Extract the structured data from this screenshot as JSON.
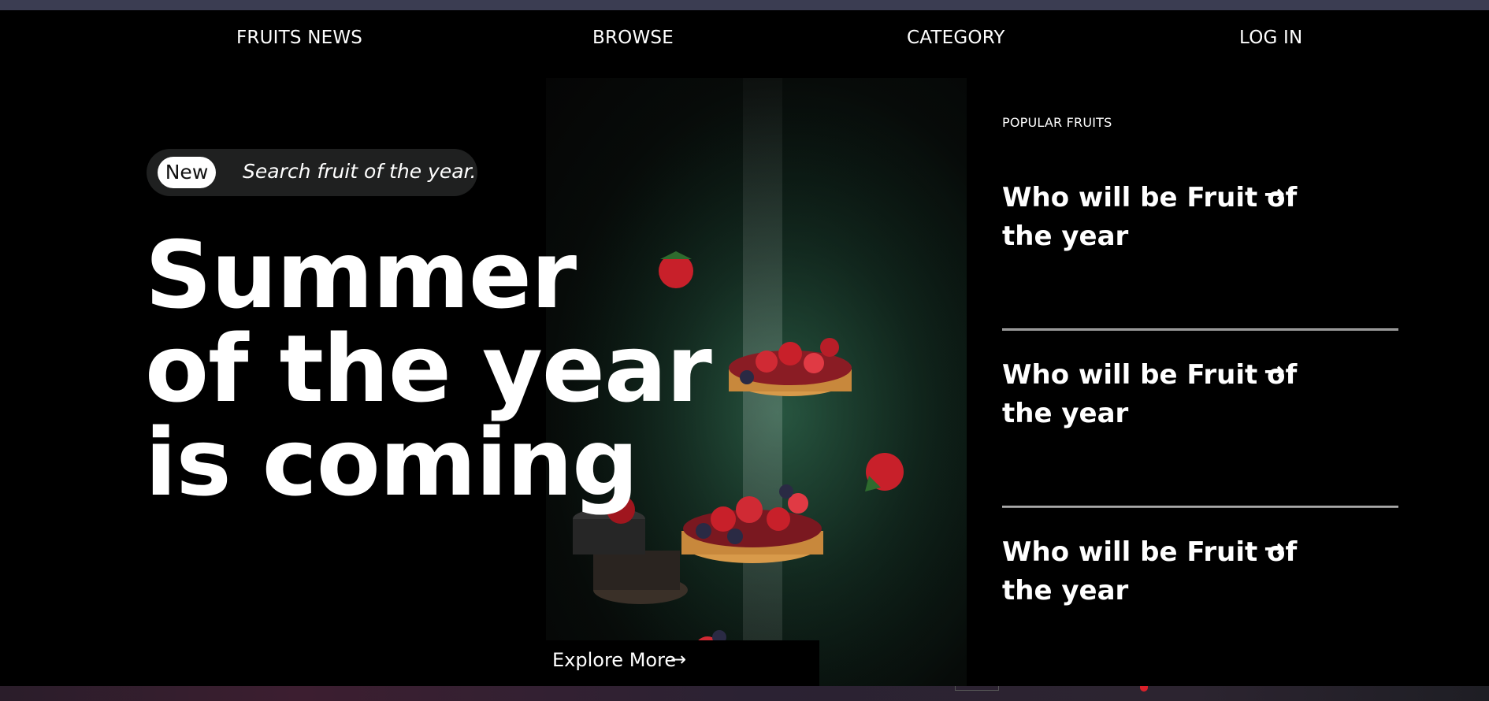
{
  "nav": {
    "items": [
      {
        "label": "FRUITS NEWS"
      },
      {
        "label": "BROWSE"
      },
      {
        "label": "CATEGORY"
      },
      {
        "label": "LOG IN"
      }
    ]
  },
  "hero": {
    "badge_new": "New",
    "badge_text": "Search fruit of the year.",
    "headline": [
      "Summer",
      "of the year",
      "is coming"
    ],
    "explore_label": "Explore More",
    "explore_icon": "arrow-right-icon"
  },
  "sidebar": {
    "heading": "POPULAR FRUITS",
    "items": [
      {
        "title": "Who will be Fruit of the year",
        "icon": "arrow-right-icon"
      },
      {
        "title": "Who will be Fruit of the year",
        "icon": "arrow-right-icon"
      },
      {
        "title": "Who will be Fruit of the year",
        "icon": "arrow-right-icon"
      }
    ]
  },
  "colors": {
    "background": "#000000",
    "text": "#ffffff",
    "pill": "#1f2020",
    "divider": "#8c8c8c",
    "accent_red": "#d9202a"
  }
}
